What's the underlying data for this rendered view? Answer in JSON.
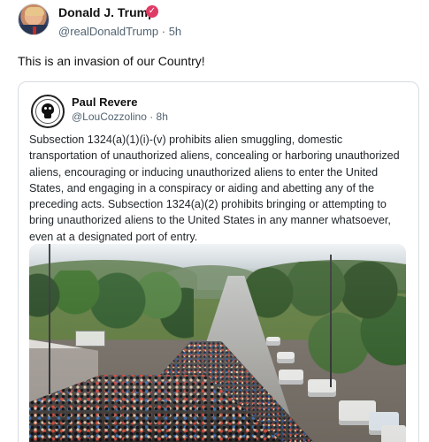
{
  "post": {
    "author": {
      "name": "Donald J. Trump",
      "handle_time": "@realDonaldTrump · 5h",
      "verified_color": "#e03b65"
    },
    "text": "This is an invasion of our Country!",
    "quote": {
      "author": {
        "name": "Paul Revere",
        "handle_time": "@LouCozzolino · 8h"
      },
      "text": "Subsection 1324(a)(1)(i)-(v) prohibits alien smuggling, domestic transportation of unauthorized aliens, concealing or harboring unauthorized aliens, encouraging or inducing unauthorized aliens to enter the United States, and engaging in a conspiracy or aiding and abetting any of the preceding acts. Subsection 1324(a)(2) prohibits bringing or attempting to bring unauthorized aliens to the United States in any manner whatsoever, even at a designated port of entry.",
      "media": {
        "type": "photo"
      }
    }
  },
  "icons": {
    "verified": "verified-badge-icon"
  },
  "colors": {
    "text": "#0f1419",
    "muted": "#536471",
    "border": "#d7dde3"
  }
}
